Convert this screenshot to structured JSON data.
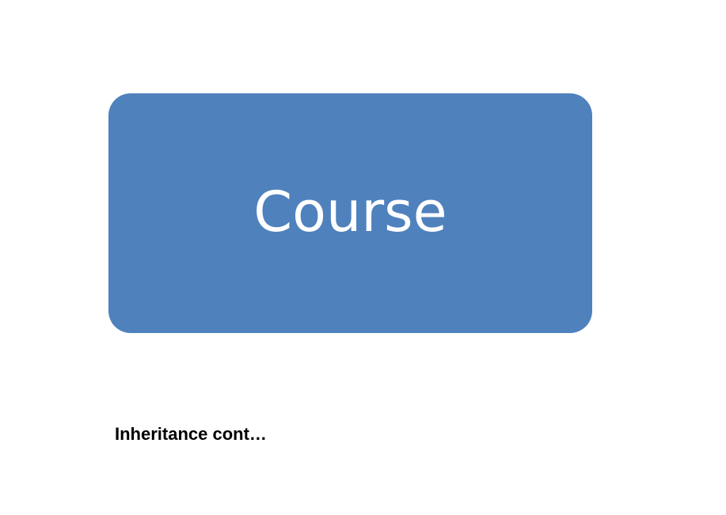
{
  "diagram": {
    "node": {
      "label": "Course",
      "fill_color": "#4f81bd",
      "text_color": "#ffffff"
    }
  },
  "caption": {
    "text": "Inheritance cont…"
  }
}
